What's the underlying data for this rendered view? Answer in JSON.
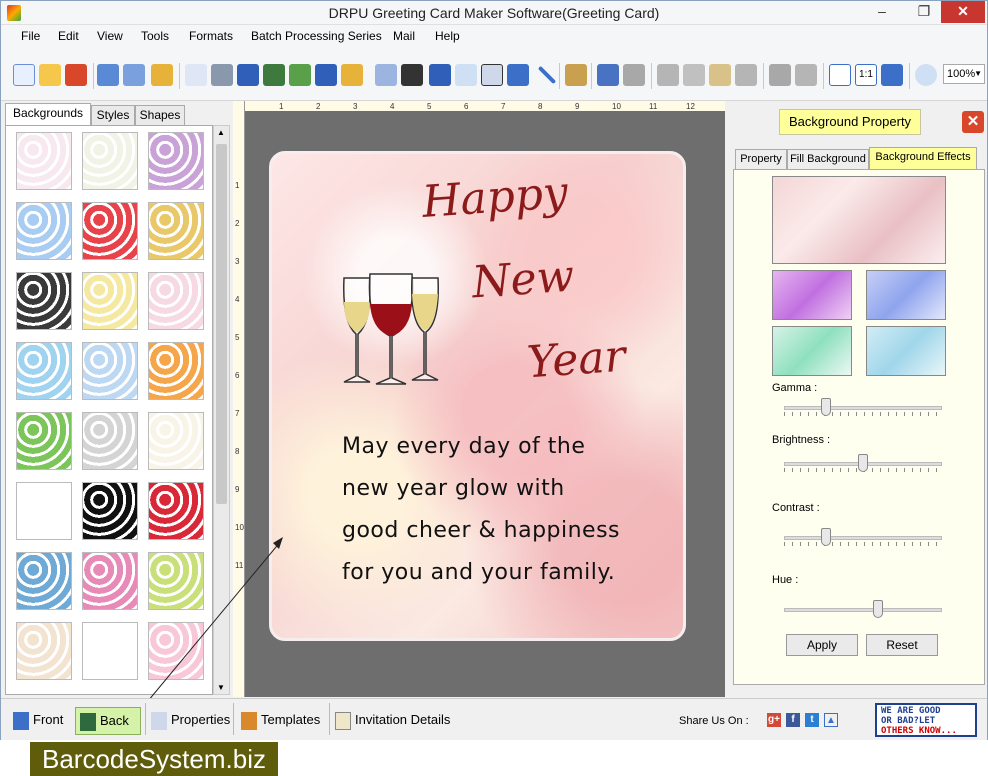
{
  "window": {
    "title": "DRPU Greeting Card Maker Software(Greeting Card)"
  },
  "menu": [
    "File",
    "Edit",
    "View",
    "Tools",
    "Formats",
    "Batch Processing Series",
    "Mail",
    "Help"
  ],
  "toolbar": {
    "zoom": "100%"
  },
  "left_panel": {
    "tabs": [
      "Backgrounds",
      "Styles",
      "Shapes"
    ],
    "active_tab": "Backgrounds",
    "thumbnails": [
      "#f7e9ef",
      "#f1f3e6",
      "#c9a3d8",
      "#a9cdf2",
      "#e8434b",
      "#e9c86a",
      "#3a3a3a",
      "#f5e8a0",
      "#f6d9e2",
      "#9fd3f0",
      "#bcd8f2",
      "#f5a64a",
      "#7bc55a",
      "#d4d4d4",
      "#f9f4e8",
      "#ffffff",
      "#111111",
      "#d92838",
      "#6fa9d6",
      "#e88ab7",
      "#c9e07a",
      "#f2e4d0",
      "#ffffff",
      "#f8c7d8"
    ]
  },
  "ruler": {
    "h_marks": [
      "1",
      "2",
      "3",
      "4",
      "5",
      "6",
      "7",
      "8",
      "9",
      "10",
      "11",
      "12"
    ],
    "v_marks": [
      "1",
      "2",
      "3",
      "4",
      "5",
      "6",
      "7",
      "8",
      "9",
      "10",
      "11"
    ]
  },
  "card": {
    "title_lines": [
      "Happy",
      "New",
      "Year"
    ],
    "message_lines": [
      "May every day of the",
      "new year glow with",
      "good cheer & happiness",
      "for you and your family."
    ]
  },
  "right_panel": {
    "header_button": "Background Property",
    "tabs": [
      "Property",
      "Fill Background",
      "Background Effects"
    ],
    "active_tab": "Background Effects",
    "sliders": [
      {
        "label": "Gamma :",
        "value": 0.25
      },
      {
        "label": "Brightness :",
        "value": 0.5
      },
      {
        "label": "Contrast :",
        "value": 0.25
      },
      {
        "label": "Hue :",
        "value": 0.6
      }
    ],
    "apply_label": "Apply",
    "reset_label": "Reset"
  },
  "bottom_bar": {
    "buttons": [
      "Front",
      "Back",
      "Properties",
      "Templates",
      "Invitation Details"
    ],
    "share_label": "Share Us On :",
    "feedback_lines": [
      "WE ARE GOOD",
      "OR BAD?LET",
      "OTHERS KNOW..."
    ]
  },
  "brand": "BarcodeSystem.biz"
}
